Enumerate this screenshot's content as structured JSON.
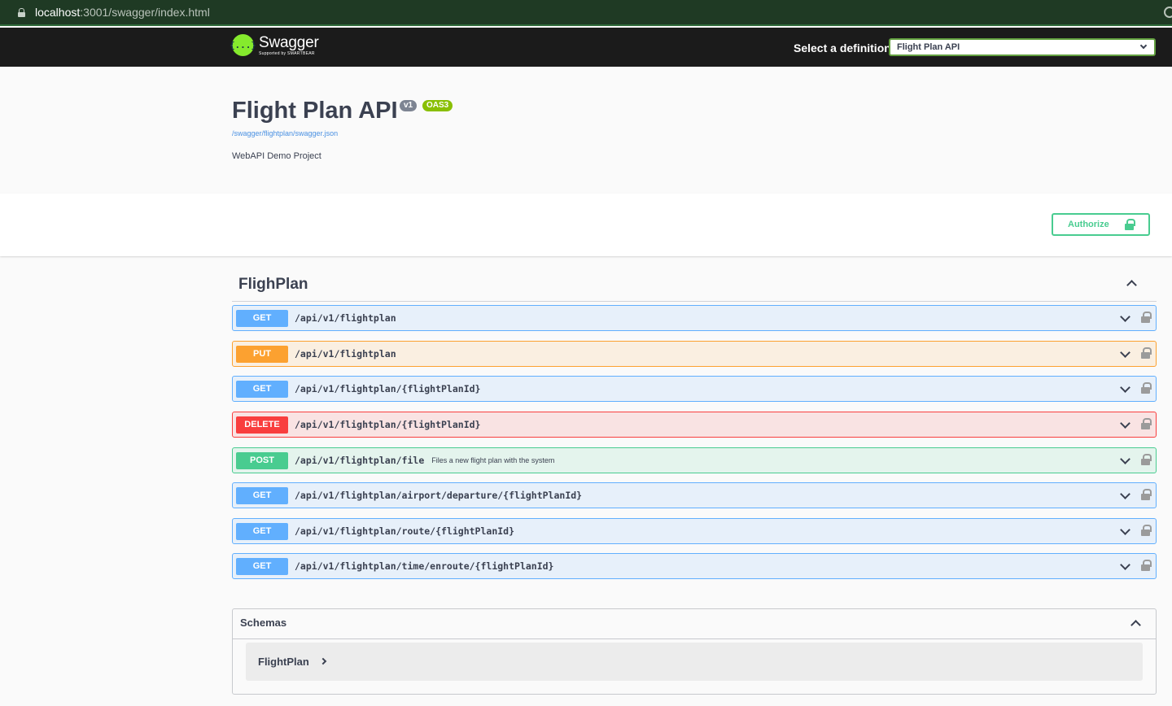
{
  "browser": {
    "url_host": "localhost",
    "url_rest": ":3001/swagger/index.html"
  },
  "topbar": {
    "logo_title": "Swagger",
    "logo_sub": "Supported by SMARTBEAR",
    "logo_glyph": "{...}",
    "definition_label": "Select a definition",
    "definition_value": "Flight Plan API"
  },
  "info": {
    "title": "Flight Plan API",
    "version": "v1",
    "oas": "OAS3",
    "spec_url": "/swagger/flightplan/swagger.json",
    "description": "WebAPI Demo Project"
  },
  "scheme": {
    "authorize_label": "Authorize"
  },
  "tag": {
    "name": "FlighPlan"
  },
  "operations": [
    {
      "method": "GET",
      "path": "/api/v1/flightplan",
      "summary": ""
    },
    {
      "method": "PUT",
      "path": "/api/v1/flightplan",
      "summary": ""
    },
    {
      "method": "GET",
      "path": "/api/v1/flightplan/{flightPlanId}",
      "summary": ""
    },
    {
      "method": "DELETE",
      "path": "/api/v1/flightplan/{flightPlanId}",
      "summary": ""
    },
    {
      "method": "POST",
      "path": "/api/v1/flightplan/file",
      "summary": "Files a new flight plan with the system"
    },
    {
      "method": "GET",
      "path": "/api/v1/flightplan/airport/departure/{flightPlanId}",
      "summary": ""
    },
    {
      "method": "GET",
      "path": "/api/v1/flightplan/route/{flightPlanId}",
      "summary": ""
    },
    {
      "method": "GET",
      "path": "/api/v1/flightplan/time/enroute/{flightPlanId}",
      "summary": ""
    }
  ],
  "schemas": {
    "title": "Schemas",
    "models": [
      "FlightPlan"
    ]
  },
  "colors": {
    "get": "#61affe",
    "put": "#fca130",
    "delete": "#f93e3e",
    "post": "#49cc90",
    "logo_green": "#85ea2d",
    "topbar": "#1b1b1b"
  }
}
